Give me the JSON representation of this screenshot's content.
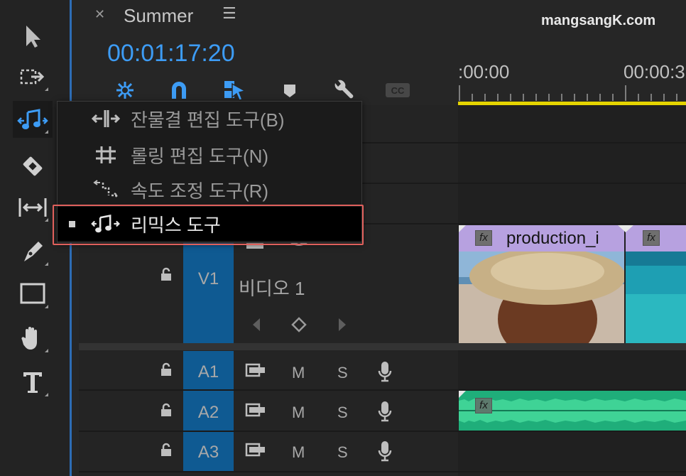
{
  "sequence": {
    "name": "Summer",
    "timecode": "00:01:17:20"
  },
  "watermark": "mangsangK.com",
  "ruler": {
    "labels": [
      ":00:00",
      "00:00:3"
    ]
  },
  "tools_menu": {
    "items": [
      {
        "label": "잔물결 편집 도구(B)",
        "icon": "ripple-edit-icon"
      },
      {
        "label": "롤링 편집 도구(N)",
        "icon": "rolling-edit-icon"
      },
      {
        "label": "속도 조정 도구(R)",
        "icon": "rate-stretch-icon"
      },
      {
        "label": "리믹스 도구",
        "icon": "remix-icon",
        "selected": true
      }
    ]
  },
  "tracks": {
    "video": [
      {
        "id": "V1",
        "name": "비디오 1"
      }
    ],
    "audio": [
      {
        "id": "A1",
        "mute": "M",
        "solo": "S"
      },
      {
        "id": "A2",
        "mute": "M",
        "solo": "S"
      },
      {
        "id": "A3",
        "mute": "M",
        "solo": "S"
      }
    ]
  },
  "clips": {
    "video_clip_name": "production_i",
    "fx": "fx"
  },
  "colors": {
    "accent_blue": "#3d9cf5",
    "track_blue": "#0f5a92",
    "clip_purple": "#b7a1e0",
    "audio_green": "#1fae7a",
    "work_bar_yellow": "#e5d400",
    "highlight_red": "#e0605c"
  }
}
